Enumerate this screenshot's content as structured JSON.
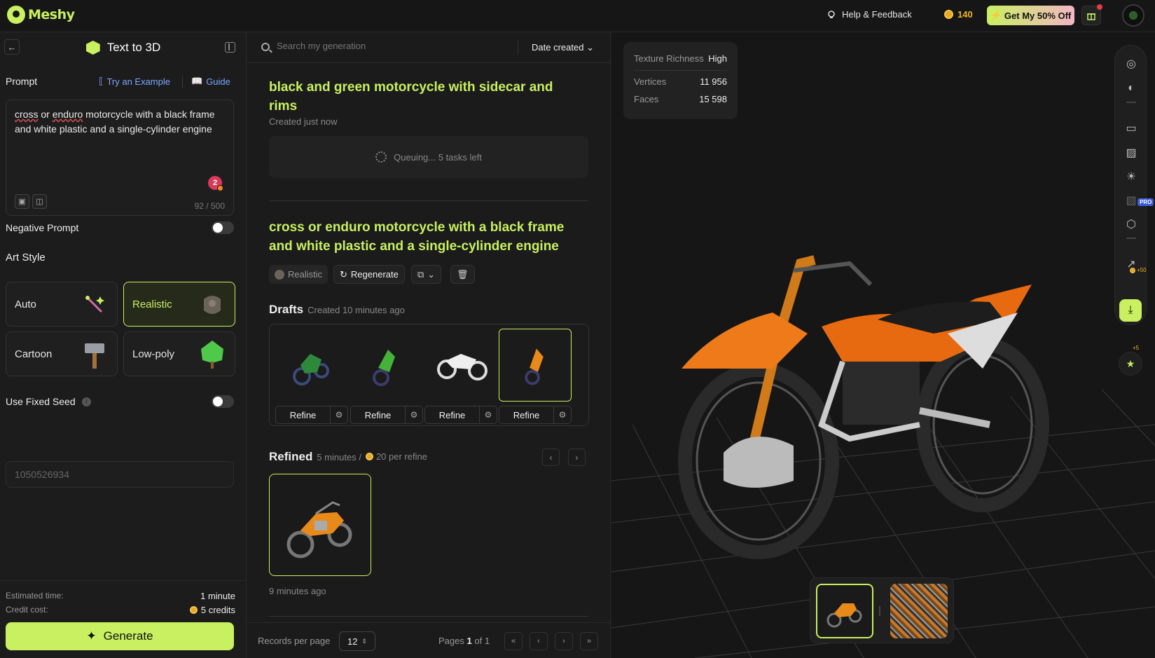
{
  "app": {
    "logo_text": "Meshy"
  },
  "topbar": {
    "help_label": "Help & Feedback",
    "credits": "140",
    "offer_label": "Get My 50% Off"
  },
  "left": {
    "title": "Text to 3D",
    "prompt_label": "Prompt",
    "try_example": "Try an Example",
    "guide": "Guide",
    "prompt_words": [
      "cross",
      " or ",
      "enduro",
      " motorcycle with a black frame and white plastic and a single-cylinder engine"
    ],
    "prompt_badge": "2",
    "char_counter": "92 / 500",
    "negative_prompt_label": "Negative Prompt",
    "art_style_label": "Art Style",
    "styles": [
      {
        "label": "Auto",
        "active": false
      },
      {
        "label": "Realistic",
        "active": true
      },
      {
        "label": "Cartoon",
        "active": false
      },
      {
        "label": "Low-poly",
        "active": false
      }
    ],
    "fixed_seed_label": "Use Fixed Seed",
    "seed_placeholder": "1050526934",
    "est_time_label": "Estimated time:",
    "est_time_value": "1 minute",
    "credit_cost_label": "Credit cost:",
    "credit_cost_value": "5 credits",
    "generate_label": "Generate"
  },
  "middle": {
    "search_placeholder": "Search my generation",
    "sort_label": "Date created",
    "task1": {
      "title": "black and green motorcycle with sidecar and rims",
      "created": "Created just now",
      "queue_text": "Queuing... 5 tasks left"
    },
    "task2": {
      "title": "cross or enduro motorcycle with a black frame and white plastic and a single-cylinder engine",
      "style_chip": "Realistic",
      "regenerate": "Regenerate"
    },
    "drafts": {
      "title": "Drafts",
      "sub": "Created 10 minutes ago",
      "refine_label": "Refine",
      "items": [
        "green-moto-1",
        "green-moto-2",
        "white-moto",
        "orange-moto"
      ]
    },
    "refined": {
      "title": "Refined",
      "sub1": "5 minutes /",
      "sub2": "20 per refine",
      "time": "9 minutes ago"
    },
    "footer": {
      "records_label": "Records per page",
      "records_value": "12",
      "pages_prefix": "Pages",
      "page_current": "1",
      "pages_suffix": "of 1"
    }
  },
  "viewer": {
    "stats": [
      {
        "k": "Texture Richness",
        "v": "High"
      },
      {
        "k": "Vertices",
        "v": "11 956"
      },
      {
        "k": "Faces",
        "v": "15 598"
      }
    ],
    "pro_badge": "PRO",
    "plus50": "+50",
    "plus5": "+5"
  },
  "colors": {
    "accent": "#c8f060",
    "link": "#7aa7ff",
    "coin": "#e8a825"
  }
}
